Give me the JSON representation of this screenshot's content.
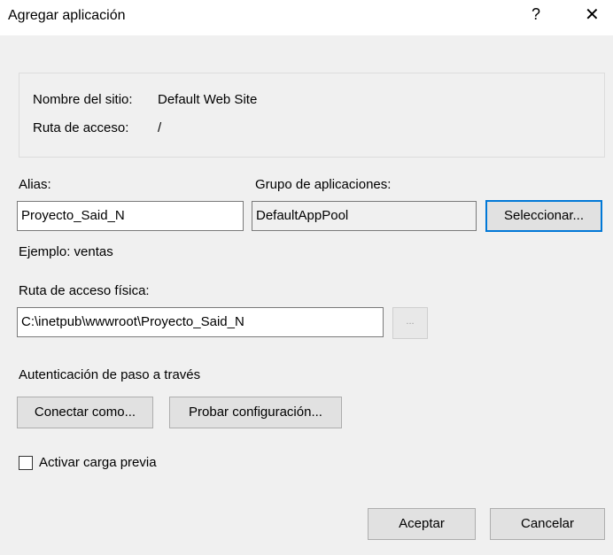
{
  "window": {
    "title": "Agregar aplicación",
    "help_glyph": "?",
    "close_glyph": "✕"
  },
  "site_info": {
    "site_name_label": "Nombre del sitio:",
    "site_name_value": "Default Web Site",
    "path_label": "Ruta de acceso:",
    "path_value": "/"
  },
  "alias": {
    "label": "Alias:",
    "value": "Proyecto_Said_N",
    "example": "Ejemplo: ventas"
  },
  "app_pool": {
    "label": "Grupo de aplicaciones:",
    "value": "DefaultAppPool",
    "select_button": "Seleccionar..."
  },
  "physical_path": {
    "label": "Ruta de acceso física:",
    "value": "C:\\inetpub\\wwwroot\\Proyecto_Said_N",
    "browse_button": "..."
  },
  "auth": {
    "label": "Autenticación de paso a través",
    "connect_as_button": "Conectar como...",
    "test_settings_button": "Probar configuración..."
  },
  "preload": {
    "label": "Activar carga previa",
    "checked": false
  },
  "footer": {
    "ok_button": "Aceptar",
    "cancel_button": "Cancelar"
  }
}
